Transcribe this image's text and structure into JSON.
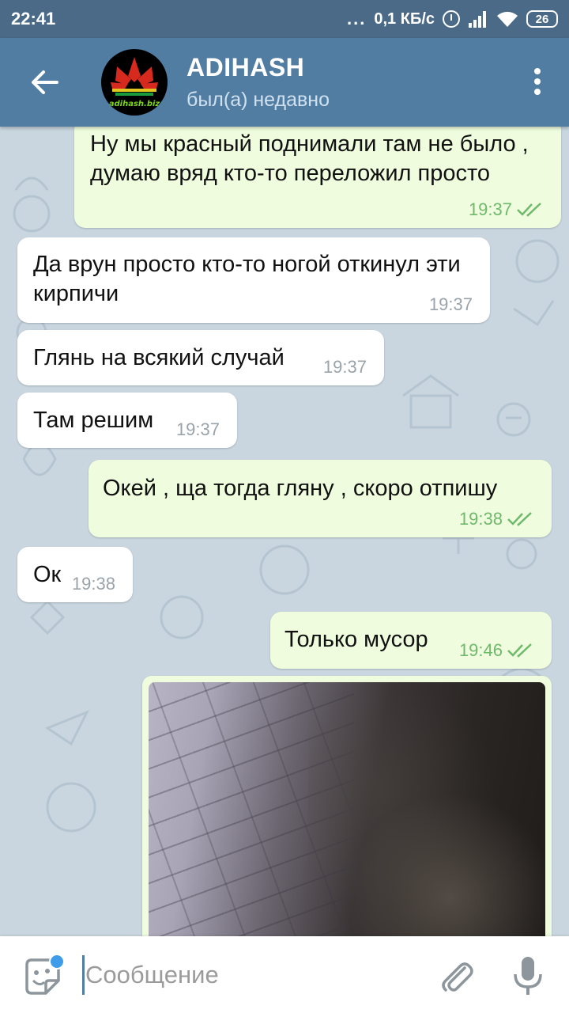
{
  "status_bar": {
    "time": "22:41",
    "dots": "...",
    "speed": "0,1 КБ/с",
    "battery": "26"
  },
  "header": {
    "title": "ADIHASH",
    "subtitle": "был(а) недавно",
    "avatar_text": "adihash.biz"
  },
  "messages": [
    {
      "dir": "out",
      "text": "Ну мы красный поднимали там не было , думаю вряд кто-то переложил просто",
      "time": "19:37"
    },
    {
      "dir": "in",
      "text": "Да врун просто кто-то ногой откинул эти кирпичи",
      "time": "19:37"
    },
    {
      "dir": "in",
      "text": "Глянь на всякий случай",
      "time": "19:37"
    },
    {
      "dir": "in",
      "text": "Там решим",
      "time": "19:37"
    },
    {
      "dir": "out",
      "text": "Окей , ща тогда гляну , скоро отпишу",
      "time": "19:38"
    },
    {
      "dir": "in",
      "text": "Ок",
      "time": "19:38"
    },
    {
      "dir": "out",
      "text": "Только мусор",
      "time": "19:46"
    }
  ],
  "input": {
    "placeholder": "Сообщение"
  },
  "colors": {
    "header": "#517da2",
    "status_bar": "#4a6a87",
    "outgoing_bubble": "#effdde",
    "incoming_bubble": "#ffffff",
    "read_check": "#6fb96b",
    "unread_dot": "#3f9ce8"
  },
  "icons": [
    "back-arrow-icon",
    "more-vert-icon",
    "double-check-icon",
    "sticker-icon",
    "paperclip-icon",
    "microphone-icon"
  ]
}
